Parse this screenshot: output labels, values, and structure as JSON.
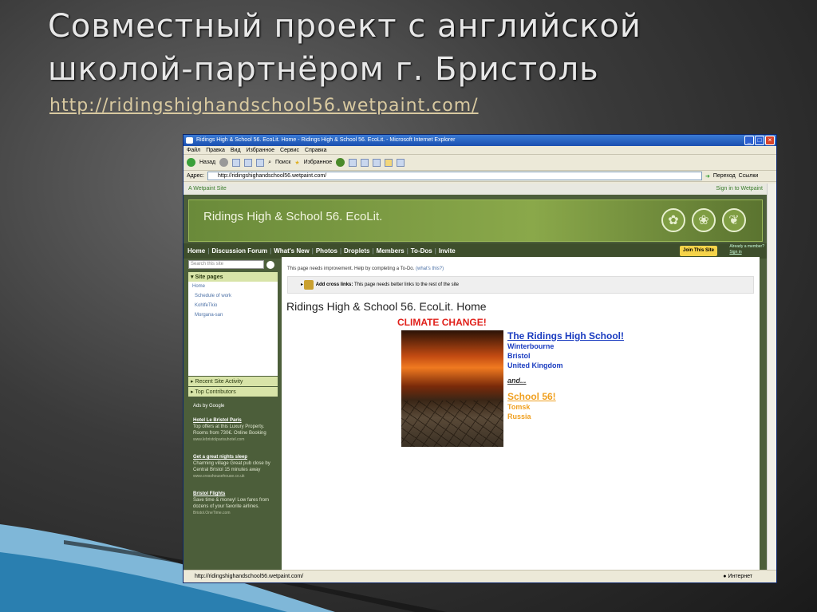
{
  "slide": {
    "title_line1": "Совместный проект с английской",
    "title_line2": "школой-партнёром г. Бристоль",
    "link": "http://ridingshighandschool56.wetpaint.com/"
  },
  "browser": {
    "title": "Ridings High & School 56. EcoLit. Home - Ridings High & School 56. EcoLit. - Microsoft Internet Explorer",
    "menu": [
      "Файл",
      "Правка",
      "Вид",
      "Избранное",
      "Сервис",
      "Справка"
    ],
    "toolbar": {
      "back": "Назад",
      "search": "Поиск",
      "favorites": "Избранное"
    },
    "address_label": "Адрес:",
    "address": "http://ridingshighandschool56.wetpaint.com/",
    "go": "Переход",
    "links": "Ссылки",
    "status_url": "http://ridingshighandschool56.wetpaint.com/",
    "status_zone": "Интернет"
  },
  "wetpaint": {
    "top_left": "A Wetpaint Site",
    "top_right": "Sign in to Wetpaint",
    "site_title": "Ridings High & School 56. EcoLit.",
    "nav": [
      "Home",
      "Discussion Forum",
      "What's New",
      "Photos",
      "Droplets",
      "Members",
      "To-Dos",
      "Invite"
    ],
    "join": "Join This Site",
    "already_member": "Already a member?",
    "sign_in": "Sign in",
    "search_placeholder": "Search this site",
    "site_pages_label": "Site pages",
    "pages": [
      "Home",
      "Schedule of work",
      "KohlfeTkio",
      "Morgana-san"
    ],
    "recent_activity": "Recent Site Activity",
    "top_contributors": "Top Contributors",
    "ads_by": "Ads by Google",
    "ads": [
      {
        "title": "Hotel Le Bristol Paris",
        "text": "Top offers at this Luxury Property. Rooms from 730€. Online Booking",
        "url": "www.lebristolparisuhotel.com"
      },
      {
        "title": "Get a great nights sleep",
        "text": "Charming village Great pub close by Central Bristol 15 minutes away",
        "url": "www.crosshousehouse.co.uk"
      },
      {
        "title": "Bristol Flights",
        "text": "Save time & money! Low fares from dozens of your favorite airlines.",
        "url": "Bristol.OneTime.com"
      }
    ],
    "todo_text": "This page needs improvement. Help by completing a To-Do.",
    "todo_link": "(what's this?)",
    "crosslinks_bold": "Add cross links:",
    "crosslinks_text": "This page needs better links to the rest of the site",
    "page_heading": "Ridings High & School 56. EcoLit. Home",
    "climate": "CLIMATE CHANGE!",
    "school1": "The Ridings High School!",
    "school1_lines": [
      "Winterbourne",
      "Bristol",
      "United Kingdom"
    ],
    "and": "and...",
    "school2": "School 56!",
    "school2_lines": [
      "Tomsk",
      "Russia"
    ]
  }
}
